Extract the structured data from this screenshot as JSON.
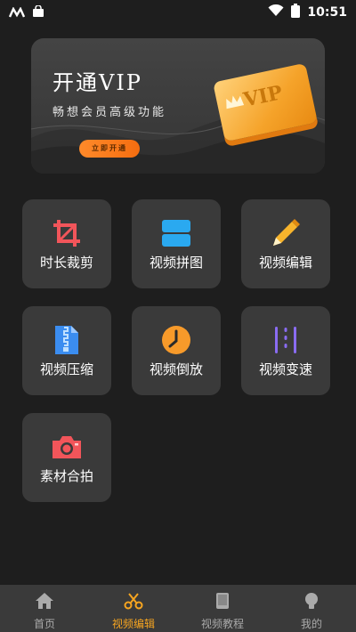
{
  "status_bar": {
    "time": "10:51"
  },
  "banner": {
    "title": "开通VIP",
    "subtitle": "畅想会员高级功能",
    "button_label": "立即开通",
    "card_text": "VIP"
  },
  "tools": [
    {
      "label": "时长裁剪",
      "icon": "crop-icon"
    },
    {
      "label": "视频拼图",
      "icon": "layout-split-icon"
    },
    {
      "label": "视频编辑",
      "icon": "pencil-icon"
    },
    {
      "label": "视频压缩",
      "icon": "zip-icon"
    },
    {
      "label": "视频倒放",
      "icon": "clock-icon"
    },
    {
      "label": "视频变速",
      "icon": "speed-bars-icon"
    },
    {
      "label": "素材合拍",
      "icon": "camera-icon"
    }
  ],
  "tabs": [
    {
      "label": "首页",
      "icon": "home-icon",
      "active": false
    },
    {
      "label": "视频编辑",
      "icon": "scissors-icon",
      "active": true
    },
    {
      "label": "视频教程",
      "icon": "book-icon",
      "active": false
    },
    {
      "label": "我的",
      "icon": "profile-icon",
      "active": false
    }
  ],
  "colors": {
    "accent": "#f7a520",
    "tile_bg": "#3a3a3a",
    "background": "#1e1e1e"
  }
}
